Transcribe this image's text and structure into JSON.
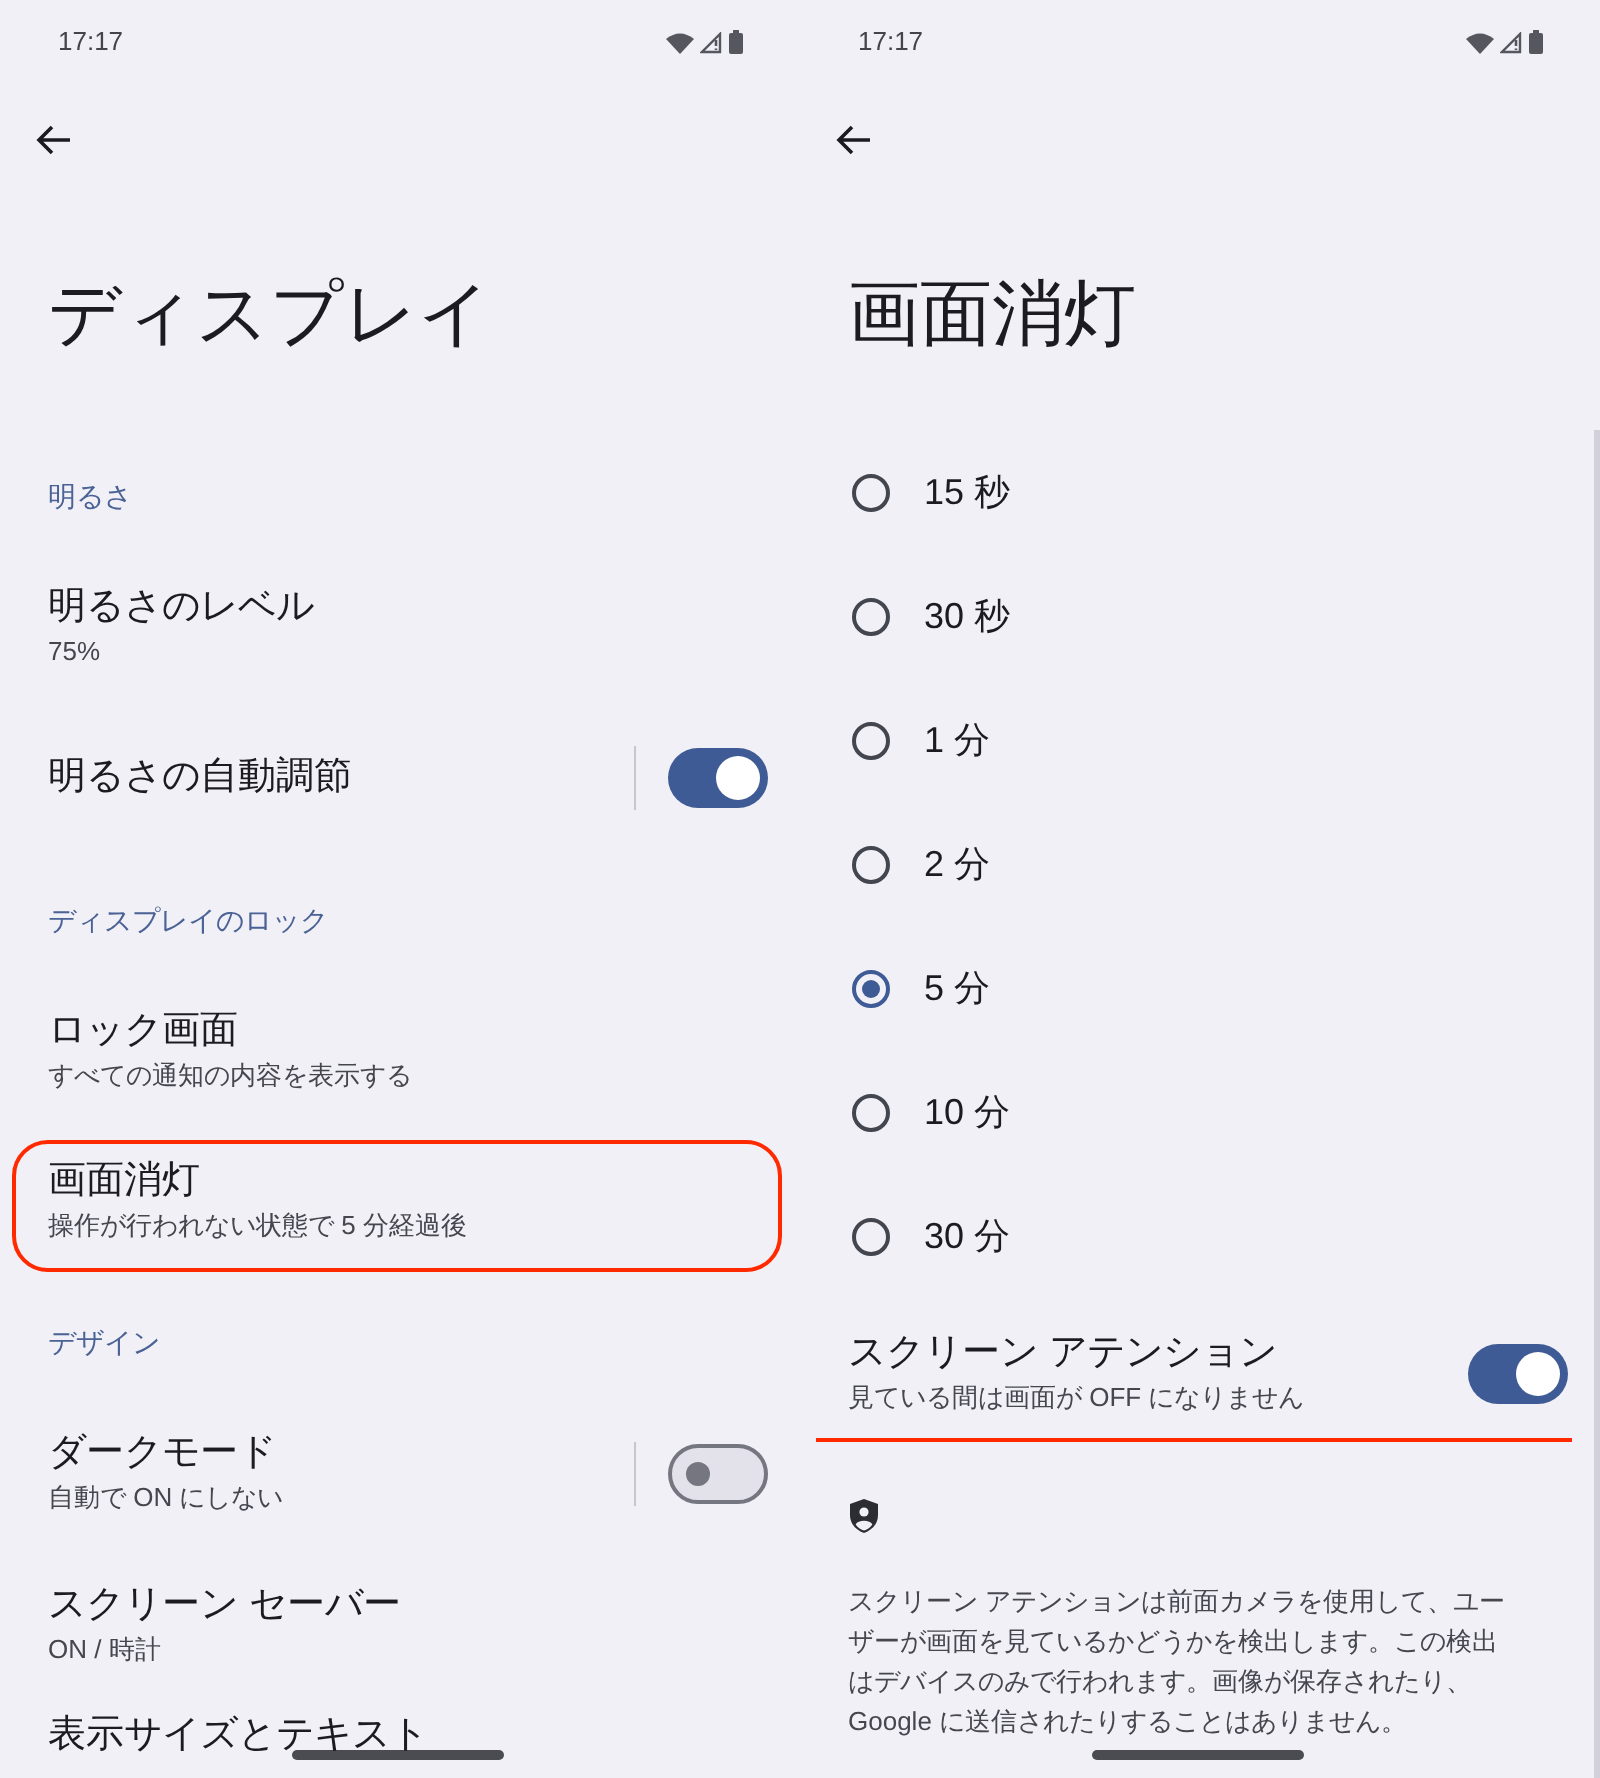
{
  "screens": [
    {
      "status_bar": {
        "time": "17:17"
      },
      "title": "ディスプレイ",
      "items": [
        {
          "kind": "header",
          "title": "明るさ"
        },
        {
          "kind": "setting",
          "title": "明るさのレベル",
          "summary": "75%"
        },
        {
          "kind": "switch",
          "title": "明るさの自動調節",
          "on": true,
          "divided": true
        },
        {
          "kind": "header",
          "title": "ディスプレイのロック"
        },
        {
          "kind": "setting",
          "title": "ロック画面",
          "summary": "すべての通知の内容を表示する"
        },
        {
          "kind": "setting",
          "title": "画面消灯",
          "summary": "操作が行われない状態で 5 分経過後",
          "highlighted": true
        },
        {
          "kind": "header",
          "title": "デザイン"
        },
        {
          "kind": "switch",
          "title": "ダークモード",
          "summary": "自動で ON にしない",
          "on": false,
          "divided": true
        },
        {
          "kind": "setting",
          "title": "スクリーン セーバー",
          "summary": "ON / 時計"
        },
        {
          "kind": "setting",
          "title": "表示サイズとテキスト"
        }
      ]
    },
    {
      "status_bar": {
        "time": "17:17"
      },
      "title": "画面消灯",
      "items": [
        {
          "kind": "radio",
          "title": "15 秒",
          "selected": false
        },
        {
          "kind": "radio",
          "title": "30 秒",
          "selected": false
        },
        {
          "kind": "radio",
          "title": "1 分",
          "selected": false
        },
        {
          "kind": "radio",
          "title": "2 分",
          "selected": false
        },
        {
          "kind": "radio",
          "title": "5 分",
          "selected": true
        },
        {
          "kind": "radio",
          "title": "10 分",
          "selected": false
        },
        {
          "kind": "radio",
          "title": "30 分",
          "selected": false
        },
        {
          "kind": "switch",
          "title": "スクリーン アテンション",
          "summary": "見ている間は画面が OFF になりません",
          "on": true,
          "divided": false,
          "underlined": true
        },
        {
          "kind": "icon"
        },
        {
          "kind": "footer",
          "title": "スクリーン アテンションは前面カメラを使用して、ユーザーが画面を見ているかどうかを検出します。この検出はデバイスのみで行われます。画像が保存されたり、Google に送信されたりすることはありません。"
        }
      ]
    }
  ]
}
